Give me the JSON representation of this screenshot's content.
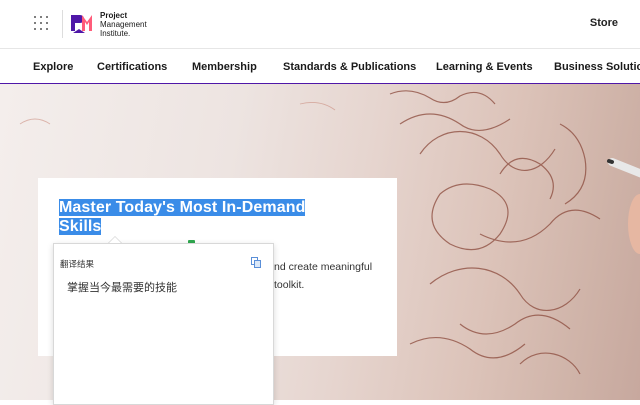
{
  "header": {
    "logo": {
      "line1": "Project",
      "line2": "Management",
      "line3": "Institute."
    },
    "store_label": "Store"
  },
  "nav": {
    "items": [
      {
        "label": "Explore"
      },
      {
        "label": "Certifications"
      },
      {
        "label": "Membership"
      },
      {
        "label": "Standards & Publications"
      },
      {
        "label": "Learning & Events"
      },
      {
        "label": "Business Solutions"
      }
    ]
  },
  "hero": {
    "title_line1": "Master Today's Most In-Demand",
    "title_line2": "Skills",
    "desc_line1": "nd create meaningful",
    "desc_line2": "toolkit."
  },
  "translate_popup": {
    "label": "翻译结果",
    "result": "掌握当今最需要的技能"
  },
  "colors": {
    "nav_underline": "#4f17a8",
    "selection": "#3a8ce8",
    "logo_purple": "#4f17a8",
    "logo_pink": "#ff5c7a"
  }
}
